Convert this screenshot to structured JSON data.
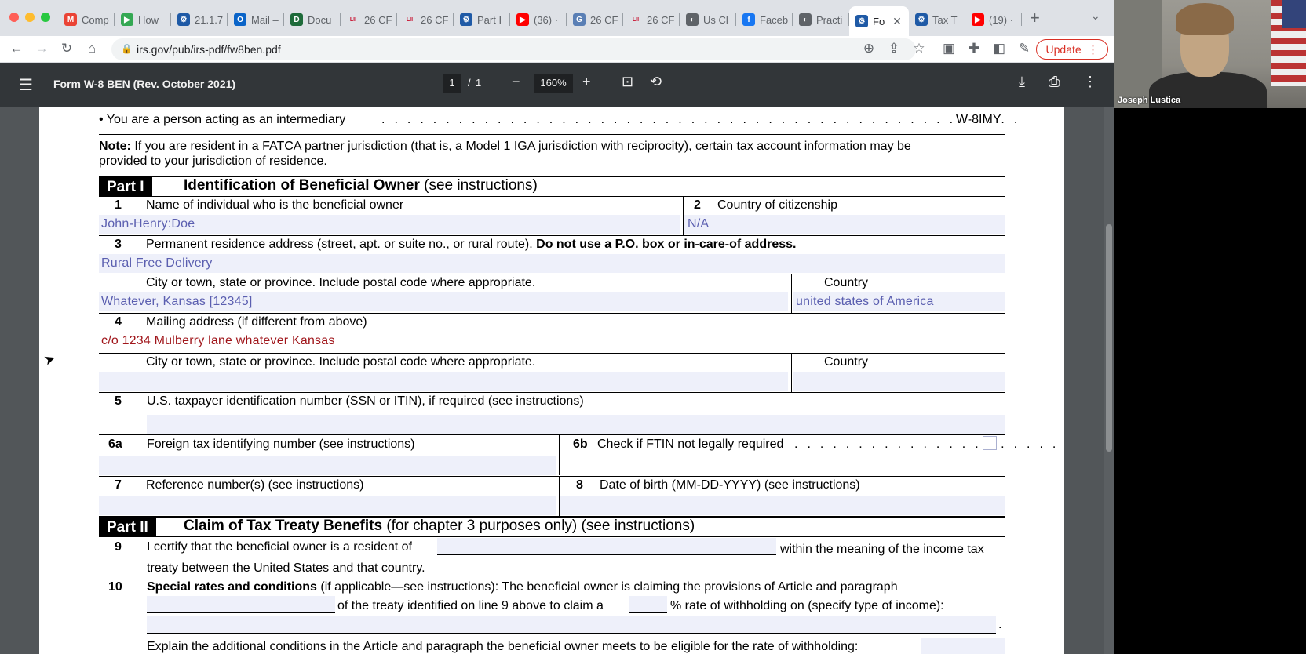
{
  "browser": {
    "tabs": [
      {
        "label": "Comp",
        "icon": "gmail-icon",
        "color": "#ea4335",
        "glyph": "M"
      },
      {
        "label": "How",
        "icon": "play-icon",
        "color": "#34a853",
        "glyph": "▶"
      },
      {
        "label": "21.1.7",
        "icon": "irs-icon",
        "color": "#1f5aa6",
        "glyph": "⚙"
      },
      {
        "label": "Mail –",
        "icon": "outlook-icon",
        "color": "#0a64c8",
        "glyph": "O"
      },
      {
        "label": "Docu",
        "icon": "docs-icon",
        "color": "#1e6b3a",
        "glyph": "D"
      },
      {
        "label": "26 CF",
        "icon": "lii-icon",
        "color": "#c8102e",
        "glyph": "LII"
      },
      {
        "label": "26 CF",
        "icon": "lii-icon",
        "color": "#c8102e",
        "glyph": "LII"
      },
      {
        "label": "Part I",
        "icon": "irs-icon",
        "color": "#1f5aa6",
        "glyph": "⚙"
      },
      {
        "label": "(36) ·",
        "icon": "youtube-icon",
        "color": "#ff0000",
        "glyph": "▶"
      },
      {
        "label": "26 CF",
        "icon": "govinfo-icon",
        "color": "#5a7fb5",
        "glyph": "G"
      },
      {
        "label": "26 CF",
        "icon": "lii-icon",
        "color": "#c8102e",
        "glyph": "LII"
      },
      {
        "label": "Us Cl",
        "icon": "globe-icon",
        "color": "#5f6368",
        "glyph": "◐"
      },
      {
        "label": "Faceb",
        "icon": "facebook-icon",
        "color": "#1877f2",
        "glyph": "f"
      },
      {
        "label": "Practi",
        "icon": "globe-icon",
        "color": "#5f6368",
        "glyph": "◐"
      },
      {
        "label": "Fo",
        "icon": "irs-icon",
        "color": "#1f5aa6",
        "glyph": "⚙",
        "active": true
      },
      {
        "label": "Tax T",
        "icon": "irs-icon",
        "color": "#1f5aa6",
        "glyph": "⚙"
      },
      {
        "label": "(19) ·",
        "icon": "youtube-icon",
        "color": "#ff0000",
        "glyph": "▶"
      }
    ],
    "url": "irs.gov/pub/irs-pdf/fw8ben.pdf",
    "update_label": "Update"
  },
  "pdf": {
    "title": "Form W-8 BEN (Rev. October 2021)",
    "page_current": "1",
    "page_sep": "/",
    "page_total": "1",
    "zoom": "160%"
  },
  "form": {
    "intermediary_line": "• You are a person acting as an intermediary",
    "intermediary_form": "W-8IMY",
    "note_label": "Note:",
    "note_text_1": " If you are resident in a FATCA partner jurisdiction (that is, a Model 1 IGA jurisdiction with reciprocity), certain tax account information may be",
    "note_text_2": "provided to your jurisdiction of residence.",
    "part1": {
      "badge": "Part I",
      "title_bold": "Identification of Beneficial Owner",
      "title_rest": " (see instructions)"
    },
    "line1": {
      "num": "1",
      "label": "Name of individual who is the beneficial owner",
      "value": "John-Henry:Doe"
    },
    "line2": {
      "num": "2",
      "label": "Country of citizenship",
      "value": "N/A"
    },
    "line3": {
      "num": "3",
      "label": "Permanent residence address (street, apt. or suite no., or rural route).",
      "label_bold": " Do not use a P.O. box or in-care-of address.",
      "value": "Rural Free Delivery",
      "city_label": "City or town, state or province. Include postal code where appropriate.",
      "city_value": "Whatever, Kansas [12345]",
      "country_label": "Country",
      "country_value": "united states of America"
    },
    "line4": {
      "num": "4",
      "label": "Mailing address (if different from above)",
      "value": "c/o 1234 Mulberry lane whatever Kansas",
      "city_label": "City or town, state or province. Include postal code where appropriate.",
      "country_label": "Country"
    },
    "line5": {
      "num": "5",
      "label": "U.S. taxpayer identification number (SSN or ITIN), if required (see instructions)"
    },
    "line6a": {
      "num": "6a",
      "label": "Foreign tax identifying number (see instructions)"
    },
    "line6b": {
      "num": "6b",
      "label": "Check if FTIN not legally required"
    },
    "line7": {
      "num": "7",
      "label": "Reference number(s) (see instructions)"
    },
    "line8": {
      "num": "8",
      "label": "Date of birth (MM-DD-YYYY) (see instructions)"
    },
    "part2": {
      "badge": "Part II",
      "title_bold": "Claim of Tax Treaty Benefits",
      "title_rest": " (for chapter 3 purposes only) (see instructions)"
    },
    "line9": {
      "num": "9",
      "text_a": "I certify that the beneficial owner is a resident of",
      "text_b": "within the meaning of the income tax",
      "text_c": "treaty between the United States and that country."
    },
    "line10": {
      "num": "10",
      "bold": "Special rates and conditions",
      "text_a": " (if applicable—see instructions): The beneficial owner is claiming the provisions of Article and paragraph",
      "text_b": "of the treaty identified on line 9 above to claim a",
      "text_c": "% rate of withholding on (specify type of income):",
      "text_d": "Explain the additional conditions in the Article and paragraph the beneficial owner meets to be eligible for the rate of withholding:"
    }
  },
  "webcam": {
    "name": "Joseph Lustica"
  }
}
